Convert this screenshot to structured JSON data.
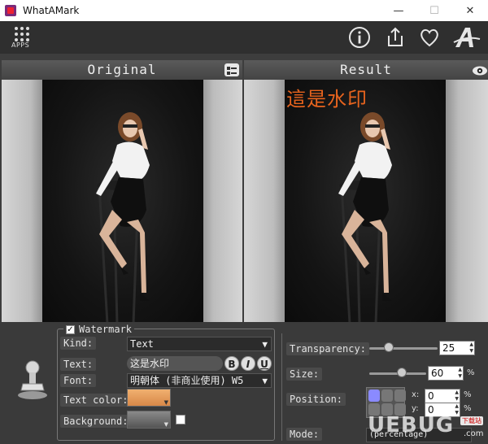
{
  "window": {
    "title": "WhatAMark",
    "minimize": "—",
    "maximize": "☐",
    "close": "✕"
  },
  "toolbar": {
    "apps_label": "APPS",
    "icons": [
      "info-icon",
      "share-icon",
      "heart-icon",
      "font-a-icon"
    ]
  },
  "panels": {
    "original": {
      "title": "Original"
    },
    "result": {
      "title": "Result",
      "watermark_text": "這是水印",
      "watermark_color": "#e8641e"
    }
  },
  "watermark": {
    "checkbox_label": "Watermark",
    "checked": true,
    "kind_label": "Kind:",
    "kind_value": "Text",
    "text_label": "Text:",
    "text_value": "这是水印",
    "bold": "B",
    "italic": "I",
    "underline": "U",
    "font_label": "Font:",
    "font_value": "明朝体 (非商业使用) W5",
    "text_color_label": "Text color:",
    "text_color": "#e8a060",
    "background_label": "Background:"
  },
  "settings": {
    "transparency_label": "Transparency:",
    "transparency_value": "25",
    "size_label": "Size:",
    "size_value": "60",
    "size_unit": "%",
    "position_label": "Position:",
    "x_label": "x:",
    "x_value": "0",
    "y_label": "y:",
    "y_value": "0",
    "pct": "%",
    "mode_label": "Mode:",
    "mode_value": "(percentage)"
  },
  "brand_overlay": {
    "main": "UEBUG",
    "badge": "下载站",
    "domain": ".com"
  }
}
